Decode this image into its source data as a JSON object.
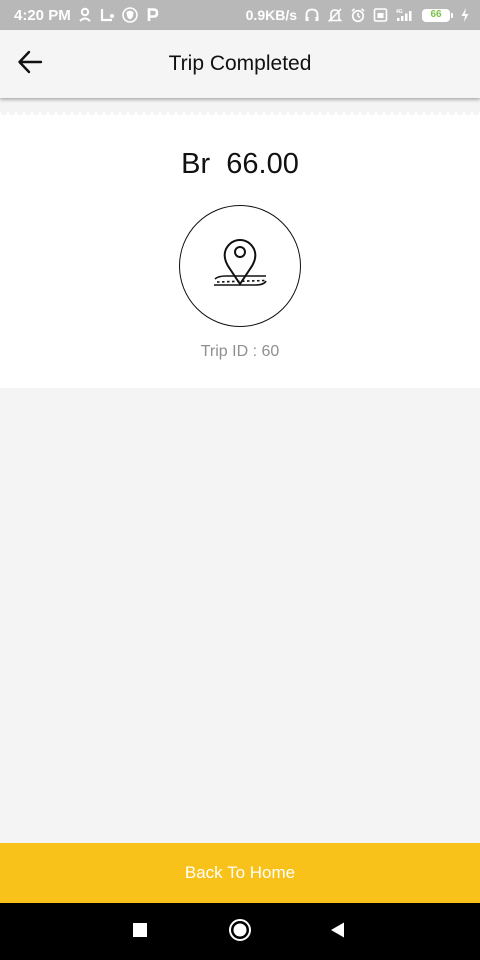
{
  "status_bar": {
    "time": "4:20 PM",
    "network_speed": "0.9KB/s",
    "battery_level": "66",
    "left_icons": [
      "location-person-icon",
      "route-icon",
      "shield-icon",
      "p-icon"
    ],
    "right_icons": [
      "headset-icon",
      "alarm-off-icon",
      "alarm-icon",
      "sim-icon",
      "signal-icon",
      "battery-icon",
      "charging-icon"
    ]
  },
  "header": {
    "title": "Trip Completed",
    "back_icon": "arrow-left-icon"
  },
  "trip": {
    "currency": "Br",
    "amount": "66.00",
    "fare_display": "Br  66.00",
    "trip_id_text": "Trip ID : 60",
    "illustration_icon": "map-pin-route-icon"
  },
  "actions": {
    "back_home_label": "Back To Home"
  },
  "colors": {
    "accent": "#f9c21a",
    "status_bar": "#b8b8b8",
    "background": "#f4f4f4",
    "card": "#ffffff",
    "muted_text": "#8f8f8f",
    "battery_text": "#7cc24a"
  },
  "navigation": {
    "icons": [
      "recent-apps-icon",
      "home-icon",
      "back-triangle-icon"
    ]
  }
}
